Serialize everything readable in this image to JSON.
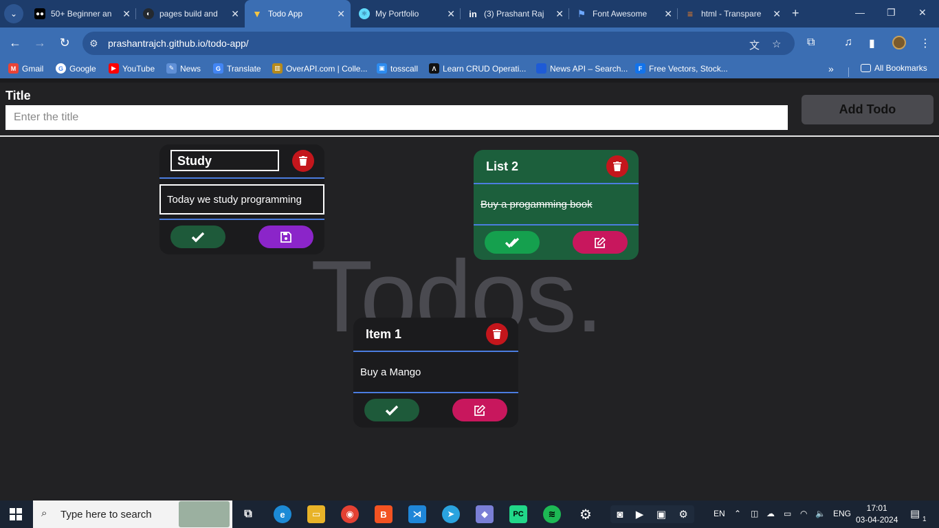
{
  "browser": {
    "tabs": [
      {
        "title": "50+ Beginner an",
        "icon": "medium-icon",
        "color": "#000000"
      },
      {
        "title": "pages build and",
        "icon": "github-icon",
        "color": "#24292f"
      },
      {
        "title": "Todo App",
        "icon": "vite-icon",
        "color": "#8a5cf6",
        "active": true
      },
      {
        "title": "My Portfolio",
        "icon": "react-icon",
        "color": "#61dafb"
      },
      {
        "title": "(3) Prashant Raj",
        "icon": "linkedin-icon",
        "color": "#0a66c2"
      },
      {
        "title": "Font Awesome",
        "icon": "fontawesome-icon",
        "color": "#228ae6"
      },
      {
        "title": "html - Transpare",
        "icon": "stackoverflow-icon",
        "color": "#f48024"
      }
    ],
    "url": "prashantrajch.github.io/todo-app/",
    "bookmarks": [
      {
        "label": "Gmail",
        "icon": "gmail-icon",
        "color": "#ea4335"
      },
      {
        "label": "Google",
        "icon": "google-icon",
        "color": "#4285f4"
      },
      {
        "label": "YouTube",
        "icon": "youtube-icon",
        "color": "#ff0000"
      },
      {
        "label": "News",
        "icon": "news-icon",
        "color": "#5f8fd6"
      },
      {
        "label": "Translate",
        "icon": "translate-icon",
        "color": "#4285f4"
      },
      {
        "label": "OverAPI.com | Colle...",
        "icon": "overapi-icon",
        "color": "#b58a1c"
      },
      {
        "label": "tosscall",
        "icon": "tosscall-icon",
        "color": "#2d8cf0"
      },
      {
        "label": "Learn CRUD Operati...",
        "icon": "learn-icon",
        "color": "#111111"
      },
      {
        "label": "News API – Search...",
        "icon": "newsapi-icon",
        "color": "#1e5bd6"
      },
      {
        "label": "Free Vectors, Stock...",
        "icon": "freepik-icon",
        "color": "#1273eb"
      }
    ],
    "all_bookmarks": "All Bookmarks"
  },
  "app": {
    "title_label": "Title",
    "title_placeholder": "Enter the title",
    "add_button": "Add Todo",
    "watermark": "Todos.",
    "todos": [
      {
        "title": "Study",
        "text": "Today we study programming",
        "editing": true,
        "done": false
      },
      {
        "title": "List 2",
        "text": "Buy a progamming book",
        "editing": false,
        "done": true
      },
      {
        "title": "Item 1",
        "text": "Buy a Mango",
        "editing": false,
        "done": false
      }
    ],
    "colors": {
      "green_dark": "#1e5a3a",
      "green_bright": "#15a04e",
      "purple": "#8b25c9",
      "pink": "#c8175d",
      "red": "#c4161c",
      "blue_line": "#4b7de0"
    }
  },
  "taskbar": {
    "search_placeholder": "Type here to search",
    "lang": "EN",
    "input_lang": "ENG",
    "time": "17:01",
    "date": "03-04-2024",
    "notification_count": "1"
  }
}
